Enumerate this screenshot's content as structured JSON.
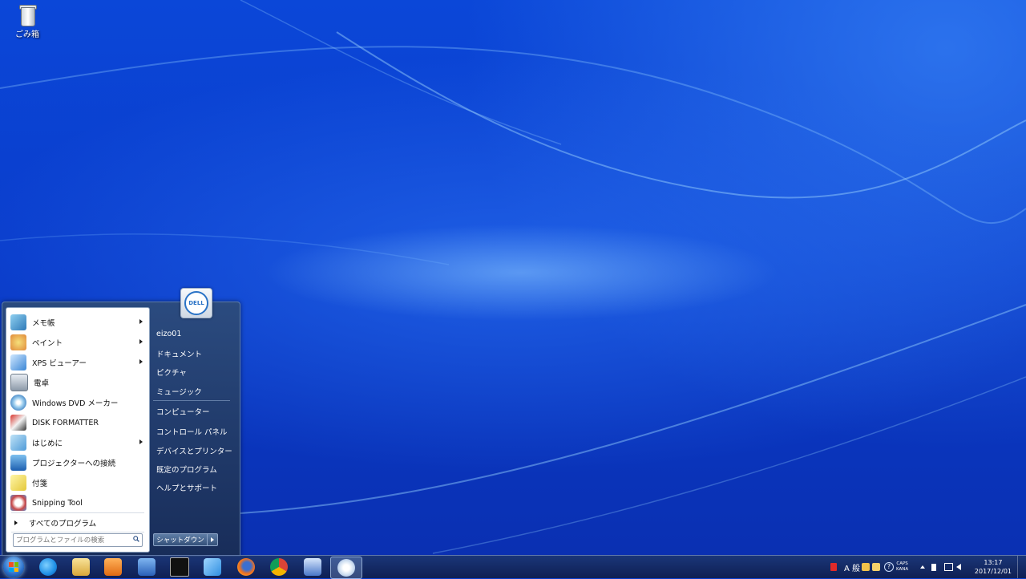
{
  "desktop": {
    "icons": [
      {
        "label": "ごみ箱",
        "icon": "recycle-bin-icon"
      }
    ]
  },
  "start_menu": {
    "programs": [
      {
        "label": "メモ帳",
        "icon": "notepad-icon",
        "submenu": true
      },
      {
        "label": "ペイント",
        "icon": "paint-icon",
        "submenu": true
      },
      {
        "label": "XPS ビューアー",
        "icon": "xps-viewer-icon",
        "submenu": true
      },
      {
        "label": "電卓",
        "icon": "calculator-icon",
        "submenu": false
      },
      {
        "label": "Windows DVD メーカー",
        "icon": "dvd-maker-icon",
        "submenu": false
      },
      {
        "label": "DISK FORMATTER",
        "icon": "disk-formatter-icon",
        "submenu": false
      },
      {
        "label": "はじめに",
        "icon": "getting-started-icon",
        "submenu": true
      },
      {
        "label": "プロジェクターへの接続",
        "icon": "projector-icon",
        "submenu": false
      },
      {
        "label": "付箋",
        "icon": "sticky-notes-icon",
        "submenu": false
      },
      {
        "label": "Snipping Tool",
        "icon": "snipping-tool-icon",
        "submenu": false
      }
    ],
    "all_programs": "すべてのプログラム",
    "search_placeholder": "プログラムとファイルの検索",
    "user_name": "eizo01",
    "user_logo_text": "DELL",
    "right_items": [
      "ドキュメント",
      "ピクチャ",
      "ミュージック",
      "コンピューター",
      "コントロール パネル",
      "デバイスとプリンター",
      "既定のプログラム",
      "ヘルプとサポート"
    ],
    "shutdown_label": "シャットダウン"
  },
  "taskbar": {
    "pinned": [
      {
        "name": "internet-explorer-icon",
        "color": "#1e8fe6"
      },
      {
        "name": "file-explorer-icon",
        "color": "#e9c45a"
      },
      {
        "name": "media-player-icon",
        "color": "#f08a24"
      },
      {
        "name": "network-app-icon",
        "color": "#3a7fd0"
      },
      {
        "name": "command-prompt-icon",
        "color": "#111111"
      },
      {
        "name": "shark-app-icon",
        "color": "#2f8ee0"
      },
      {
        "name": "firefox-icon",
        "color": "#f0701e"
      },
      {
        "name": "chrome-icon",
        "color": "#36a852"
      },
      {
        "name": "remote-desktop-icon",
        "color": "#4a78c8"
      },
      {
        "name": "paint-taskbar-icon",
        "color": "#d9e6f5"
      }
    ],
    "ime_mode": "A 般",
    "caps": "CAPS",
    "kana": "KANA",
    "time": "13:17",
    "date": "2017/12/01"
  }
}
